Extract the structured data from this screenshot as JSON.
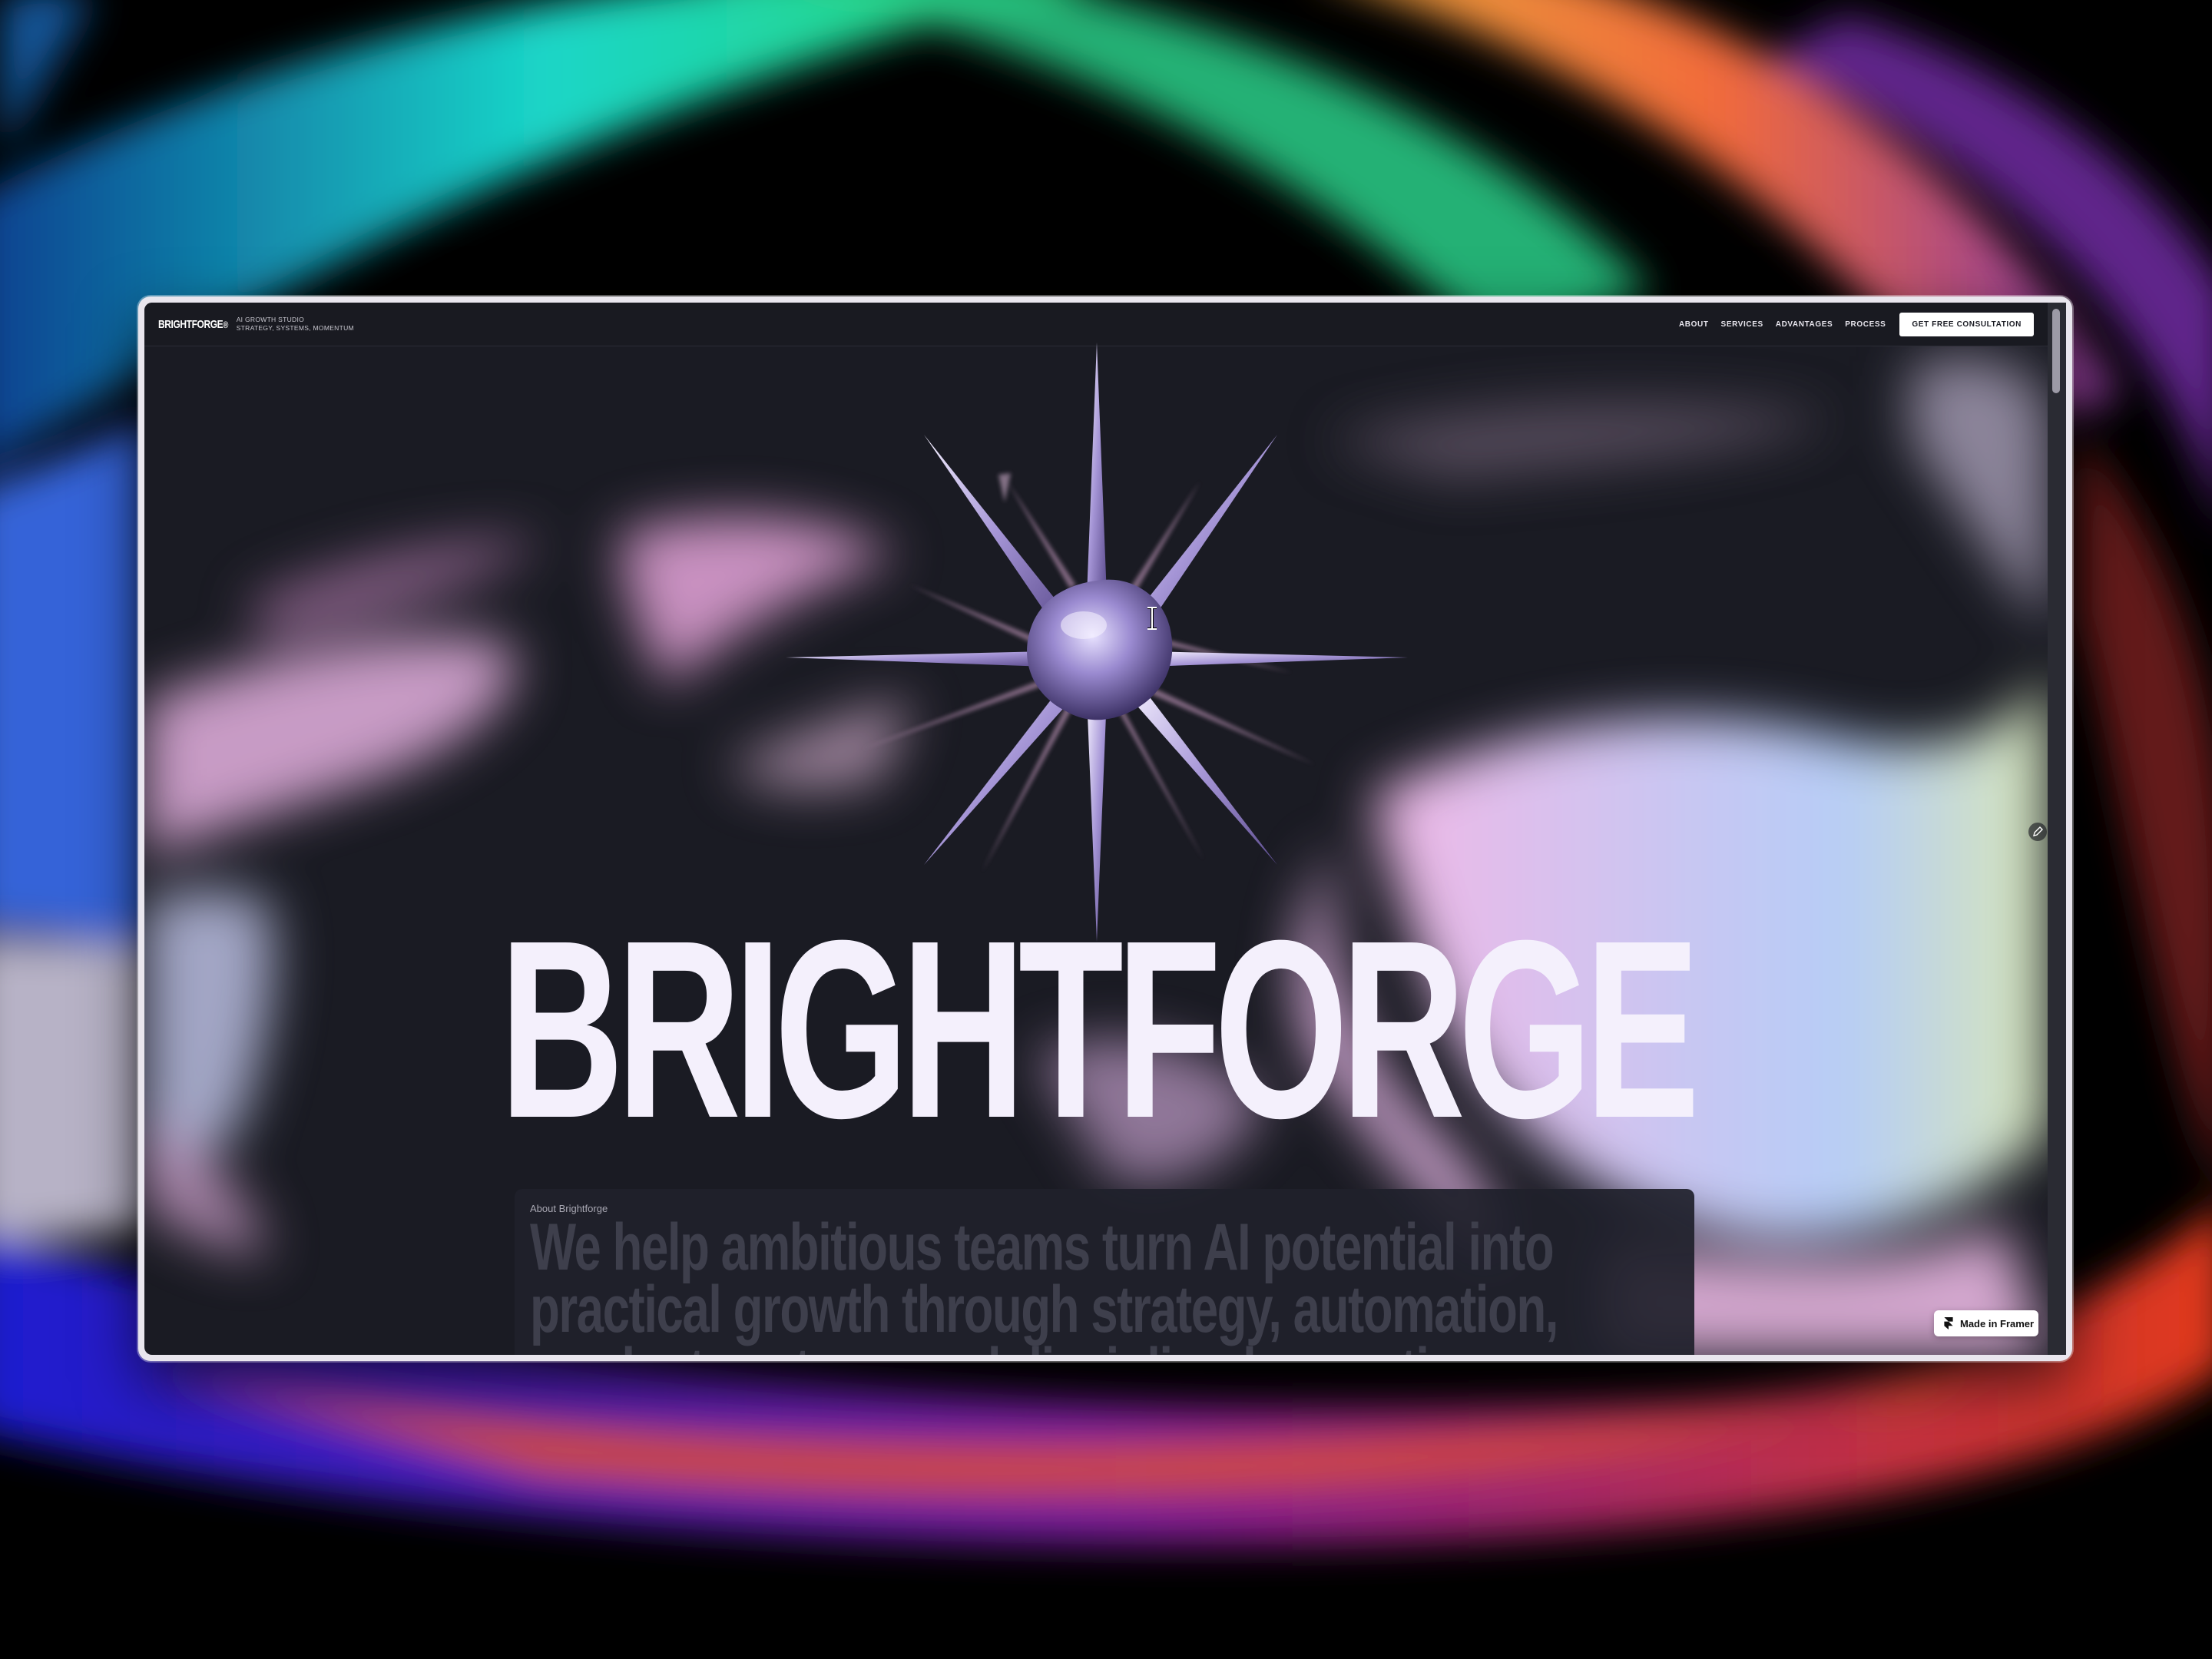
{
  "nav": {
    "logo": "BRIGHTFORGE",
    "logo_mark": "®",
    "tagline_line1": "AI GROWTH STUDIO",
    "tagline_line2": "STRATEGY, SYSTEMS, MOMENTUM",
    "links": [
      "ABOUT",
      "SERVICES",
      "ADVANTAGES",
      "PROCESS"
    ],
    "cta": "GET FREE CONSULTATION"
  },
  "hero": {
    "wordmark": "BRIGHTFORGE",
    "star_icon": "star-burst-icon"
  },
  "about": {
    "label": "About Brightforge",
    "line1": "We help ambitious teams turn AI potential into",
    "line2": "practical growth through strategy, automation,",
    "line3": "product systems and disciplined execution"
  },
  "badge": {
    "label": "Made in Framer",
    "icon": "framer-logo-icon"
  },
  "colors": {
    "page_bg": "#1a1b23",
    "wordmark": "#f4f0fc",
    "accent_star": "#a79ad8",
    "blob_pink": "#e6b8e6",
    "blob_blue": "#b8c8f4"
  }
}
